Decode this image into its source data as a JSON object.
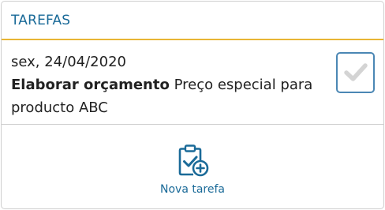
{
  "panel": {
    "title": "TAREFAS"
  },
  "task": {
    "date": "sex, 24/04/2020",
    "name": "Elaborar orçamento",
    "description": "Preço especial para producto ABC",
    "completed": false
  },
  "actions": {
    "new_task_label": "Nova tarefa",
    "new_task_icon": "clipboard-check-plus-icon"
  },
  "colors": {
    "accent": "#1a6a98",
    "header_rule": "#e8b534",
    "border": "#cfcfcf",
    "checkbox_border": "#4b87b4",
    "checkmark": "#d4d4d4"
  }
}
